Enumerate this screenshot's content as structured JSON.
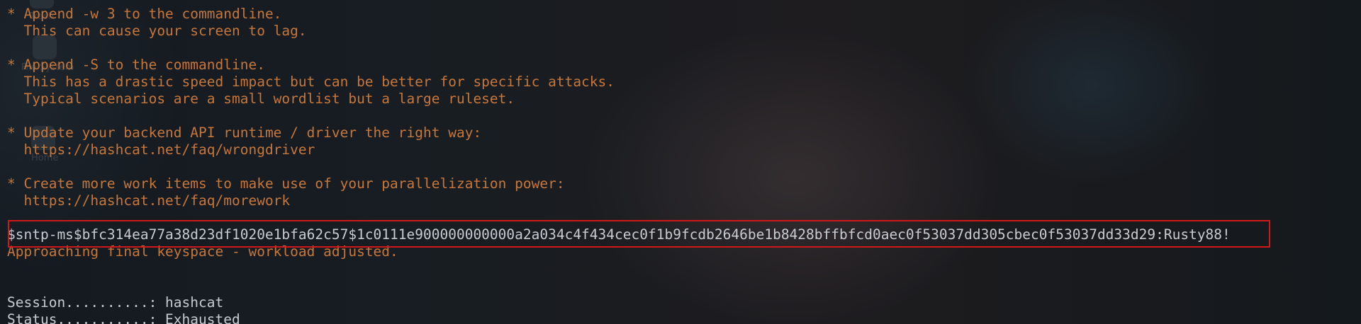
{
  "desktop": {
    "icons": [
      {
        "label": "Trash"
      },
      {
        "label": "File System"
      },
      {
        "label": "Home"
      }
    ]
  },
  "terminal": {
    "lines": [
      {
        "text": "* Append -w 3 to the commandline.",
        "style": "orange"
      },
      {
        "text": "  This can cause your screen to lag.",
        "style": "orange"
      },
      {
        "text": "",
        "style": "orange"
      },
      {
        "text": "* Append -S to the commandline.",
        "style": "orange"
      },
      {
        "text": "  This has a drastic speed impact but can be better for specific attacks.",
        "style": "orange"
      },
      {
        "text": "  Typical scenarios are a small wordlist but a large ruleset.",
        "style": "orange"
      },
      {
        "text": "",
        "style": "orange"
      },
      {
        "text": "* Update your backend API runtime / driver the right way:",
        "style": "orange"
      },
      {
        "text": "  https://hashcat.net/faq/wrongdriver",
        "style": "orange"
      },
      {
        "text": "",
        "style": "orange"
      },
      {
        "text": "* Create more work items to make use of your parallelization power:",
        "style": "orange"
      },
      {
        "text": "  https://hashcat.net/faq/morework",
        "style": "orange"
      },
      {
        "text": "",
        "style": "orange"
      },
      {
        "text": "$sntp-ms$bfc314ea77a38d23df1020e1bfa62c57$1c0111e900000000000a2a034c4f434cec0f1b9fcdb2646be1b8428bffbfcd0aec0f53037dd305cbec0f53037dd33d29:Rusty88!",
        "style": "grey"
      },
      {
        "text": "Approaching final keyspace - workload adjusted.",
        "style": "orange"
      },
      {
        "text": "",
        "style": "grey"
      },
      {
        "text": "",
        "style": "grey"
      },
      {
        "text": "Session..........: hashcat",
        "style": "grey"
      },
      {
        "text": "Status...........: Exhausted",
        "style": "grey"
      }
    ]
  },
  "colors": {
    "warning_text": "#c7773a",
    "normal_text": "#c8ccd2",
    "highlight_border": "#d01818"
  }
}
